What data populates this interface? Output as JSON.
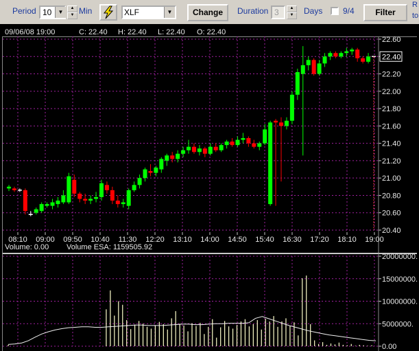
{
  "toolbar": {
    "period_label": "Period",
    "period_value": "10",
    "period_unit": "Min",
    "lightning_icon": "lightning-icon",
    "symbol": "XLF",
    "change_label": "Change",
    "duration_label": "Duration",
    "duration_value": "3",
    "days_label": "Days",
    "checkbox_label": "9/4",
    "filter_label": "Filter",
    "edge_r": "R",
    "edge_to": "to"
  },
  "info": {
    "datetime": "09/06/08 19:00",
    "c": "C: 22.40",
    "h": "H: 22.40",
    "l": "L: 22.40",
    "o": "O: 22.40",
    "volume": "Volume: 0.00",
    "volume_esa": "Volume ESA: 1159505.92"
  },
  "colors": {
    "up": "#00ff00",
    "down": "#ff0000",
    "grid": "#a020a0",
    "background": "#000000",
    "volume_bar": "#ffffcc"
  },
  "chart_data": [
    {
      "type": "candlestick",
      "x_tick_labels": [
        "08:10",
        "09:00",
        "09:50",
        "10:40",
        "11:30",
        "12:20",
        "13:10",
        "14:00",
        "14:50",
        "15:40",
        "16:30",
        "17:20",
        "18:10",
        "19:00"
      ],
      "y_tick_labels": [
        "22.60",
        "22.40",
        "22.20",
        "22.00",
        "21.80",
        "21.60",
        "21.40",
        "21.20",
        "21.00",
        "20.80",
        "20.60",
        "20.40"
      ],
      "ylim": [
        20.4,
        22.6
      ],
      "last_price_label": "22.40",
      "grid": true,
      "candles_ohlc": [
        [
          20.88,
          20.92,
          20.85,
          20.9
        ],
        [
          20.88,
          20.9,
          20.84,
          20.86
        ],
        [
          20.86,
          20.88,
          20.84,
          20.86
        ],
        [
          20.86,
          20.88,
          20.58,
          20.62
        ],
        [
          20.58,
          20.62,
          20.56,
          20.58
        ],
        [
          20.6,
          20.66,
          20.58,
          20.64
        ],
        [
          20.62,
          20.72,
          20.6,
          20.7
        ],
        [
          20.68,
          20.72,
          20.66,
          20.7
        ],
        [
          20.68,
          20.76,
          20.64,
          20.72
        ],
        [
          20.7,
          20.78,
          20.66,
          20.74
        ],
        [
          20.72,
          20.86,
          20.7,
          20.8
        ],
        [
          20.72,
          21.06,
          20.7,
          21.02
        ],
        [
          20.98,
          21.04,
          20.78,
          20.82
        ],
        [
          20.82,
          20.84,
          20.72,
          20.76
        ],
        [
          20.76,
          20.82,
          20.7,
          20.74
        ],
        [
          20.74,
          20.8,
          20.7,
          20.76
        ],
        [
          20.76,
          20.84,
          20.72,
          20.78
        ],
        [
          20.78,
          20.98,
          20.74,
          20.94
        ],
        [
          20.92,
          20.96,
          20.82,
          20.86
        ],
        [
          20.86,
          20.9,
          20.7,
          20.74
        ],
        [
          20.74,
          20.8,
          20.66,
          20.7
        ],
        [
          20.7,
          20.76,
          20.66,
          20.72
        ],
        [
          20.68,
          20.88,
          20.64,
          20.86
        ],
        [
          20.86,
          20.96,
          20.84,
          20.92
        ],
        [
          20.92,
          21.04,
          20.88,
          21.0
        ],
        [
          21.0,
          21.12,
          20.96,
          21.1
        ],
        [
          21.08,
          21.16,
          21.02,
          21.06
        ],
        [
          21.06,
          21.14,
          21.02,
          21.12
        ],
        [
          21.1,
          21.24,
          21.06,
          21.22
        ],
        [
          21.2,
          21.28,
          21.14,
          21.26
        ],
        [
          21.26,
          21.3,
          21.18,
          21.22
        ],
        [
          21.22,
          21.32,
          21.18,
          21.28
        ],
        [
          21.28,
          21.36,
          21.24,
          21.32
        ],
        [
          21.32,
          21.44,
          21.28,
          21.36
        ],
        [
          21.36,
          21.4,
          21.28,
          21.3
        ],
        [
          21.3,
          21.38,
          21.26,
          21.34
        ],
        [
          21.34,
          21.36,
          21.24,
          21.28
        ],
        [
          21.28,
          21.4,
          21.26,
          21.36
        ],
        [
          21.36,
          21.4,
          21.3,
          21.32
        ],
        [
          21.32,
          21.4,
          21.3,
          21.38
        ],
        [
          21.38,
          21.44,
          21.34,
          21.42
        ],
        [
          21.42,
          21.46,
          21.36,
          21.38
        ],
        [
          21.38,
          21.48,
          21.36,
          21.44
        ],
        [
          21.44,
          21.52,
          21.4,
          21.46
        ],
        [
          21.46,
          21.48,
          21.36,
          21.4
        ],
        [
          21.4,
          21.44,
          21.34,
          21.36
        ],
        [
          21.36,
          21.42,
          21.32,
          21.4
        ],
        [
          21.4,
          21.62,
          21.38,
          21.56
        ],
        [
          20.7,
          21.66,
          20.68,
          21.64
        ],
        [
          21.66,
          21.68,
          20.68,
          21.64
        ],
        [
          21.64,
          21.7,
          20.96,
          21.6
        ],
        [
          21.6,
          21.7,
          21.56,
          21.66
        ],
        [
          21.66,
          22.0,
          21.62,
          21.96
        ],
        [
          21.96,
          22.26,
          21.9,
          22.22
        ],
        [
          22.2,
          22.52,
          21.26,
          22.3
        ],
        [
          22.3,
          22.4,
          22.24,
          22.36
        ],
        [
          22.36,
          22.38,
          22.18,
          22.2
        ],
        [
          22.2,
          22.36,
          22.18,
          22.32
        ],
        [
          22.32,
          22.44,
          22.28,
          22.4
        ],
        [
          22.4,
          22.46,
          22.36,
          22.44
        ],
        [
          22.44,
          22.46,
          22.38,
          22.4
        ],
        [
          22.4,
          22.46,
          22.38,
          22.44
        ],
        [
          22.44,
          22.5,
          22.4,
          22.46
        ],
        [
          22.46,
          22.5,
          22.42,
          22.48
        ],
        [
          22.48,
          22.5,
          22.34,
          22.38
        ],
        [
          22.38,
          22.4,
          22.32,
          22.34
        ],
        [
          22.34,
          22.44,
          22.32,
          22.4
        ],
        [
          22.4,
          22.4,
          22.4,
          22.4
        ]
      ]
    },
    {
      "type": "bar",
      "title": "Volume",
      "y_tick_labels": [
        "20000000.",
        "15000000.",
        "10000000.",
        "5000000.",
        "0.00"
      ],
      "ylim": [
        0,
        20000000
      ],
      "values": [
        300000,
        0,
        0,
        0,
        0,
        0,
        0,
        0,
        0,
        0,
        0,
        0,
        0,
        0,
        0,
        0,
        0,
        0,
        0,
        0,
        0,
        0,
        0,
        0,
        8200000,
        12400000,
        6800000,
        10000000,
        9200000,
        5800000,
        3800000,
        4800000,
        5600000,
        5000000,
        4300000,
        3900000,
        4600000,
        5400000,
        4900000,
        3700000,
        6200000,
        7800000,
        5000000,
        4600000,
        3300000,
        5100000,
        4500000,
        5200000,
        2700000,
        4300000,
        6000000,
        1900000,
        4200000,
        5600000,
        4400000,
        3900000,
        4700000,
        5500000,
        6000000,
        4400000,
        4900000,
        5800000,
        3700000,
        6100000,
        5500000,
        6700000,
        4300000,
        5500000,
        6200000,
        4500000,
        5300000,
        2400000,
        15100000,
        15700000,
        4900000,
        1300000,
        500000,
        900000,
        300000,
        600000,
        400000,
        800000,
        300000,
        200000,
        500000,
        100000,
        300000,
        200000,
        100000,
        200000,
        0
      ],
      "esa_line": [
        400000,
        500000,
        700000,
        1200000,
        2000000,
        2700000,
        3200000,
        3600000,
        3900000,
        4100000,
        4200000,
        4300000,
        4300000,
        4200000,
        4200000,
        4300000,
        4400000,
        4500000,
        4600000,
        4700000,
        4700000,
        4600000,
        4600000,
        4600000,
        4700000,
        4800000,
        4900000,
        4900000,
        4800000,
        4800000,
        4900000,
        5000000,
        5000000,
        5100000,
        5100000,
        5100000,
        5200000,
        6200000,
        6600000,
        6100000,
        5600000,
        5100000,
        4600000,
        4200000,
        3800000,
        3400000,
        3100000,
        2800000,
        2500000,
        2300000,
        2100000,
        1900000,
        1700000,
        1500000,
        1300000,
        1200000
      ]
    }
  ]
}
